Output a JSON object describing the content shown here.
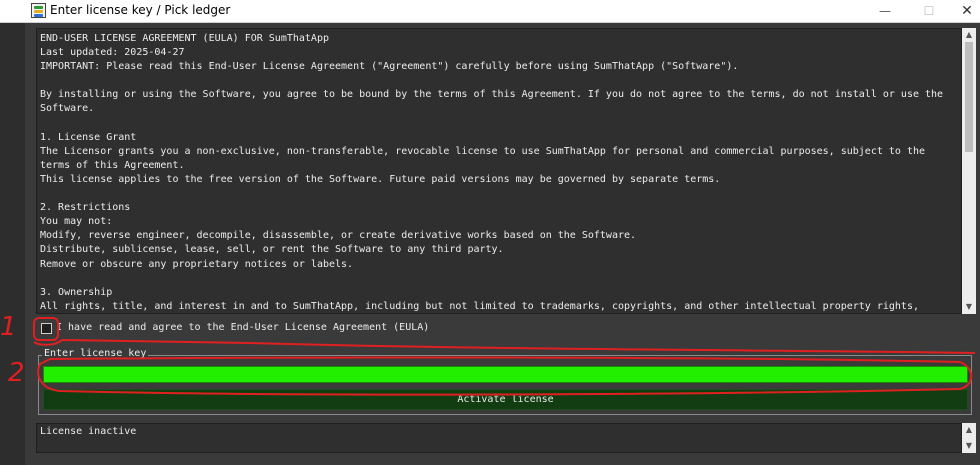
{
  "window": {
    "title": "Enter license key / Pick ledger",
    "min_label": "—",
    "max_label": "☐",
    "close_label": "✕"
  },
  "eula": {
    "lines": [
      "END-USER LICENSE AGREEMENT (EULA) FOR SumThatApp",
      "Last updated: 2025-04-27",
      "IMPORTANT: Please read this End-User License Agreement (\"Agreement\") carefully before using SumThatApp (\"Software\").",
      "",
      "By installing or using the Software, you agree to be bound by the terms of this Agreement. If you do not agree to the terms, do not install or use the",
      "Software.",
      "",
      "1. License Grant",
      "The Licensor grants you a non-exclusive, non-transferable, revocable license to use SumThatApp for personal and commercial purposes, subject to the",
      "terms of this Agreement.",
      "This license applies to the free version of the Software. Future paid versions may be governed by separate terms.",
      "",
      "2. Restrictions",
      "You may not:",
      "Modify, reverse engineer, decompile, disassemble, or create derivative works based on the Software.",
      "Distribute, sublicense, lease, sell, or rent the Software to any third party.",
      "Remove or obscure any proprietary notices or labels.",
      "",
      "3. Ownership",
      "All rights, title, and interest in and to SumThatApp, including but not limited to trademarks, copyrights, and other intellectual property rights,"
    ]
  },
  "agree": {
    "label": "I have read and agree to the End-User License Agreement (EULA)",
    "checked": false
  },
  "license": {
    "group_label": "Enter license key",
    "input_value": "",
    "activate_label": "Activate license"
  },
  "status": {
    "text": "License inactive"
  },
  "annotations": {
    "n1": "1",
    "n2": "2"
  },
  "colors": {
    "input_bg": "#22ee00",
    "button_bg": "#123d12",
    "annotation": "#e02020"
  }
}
